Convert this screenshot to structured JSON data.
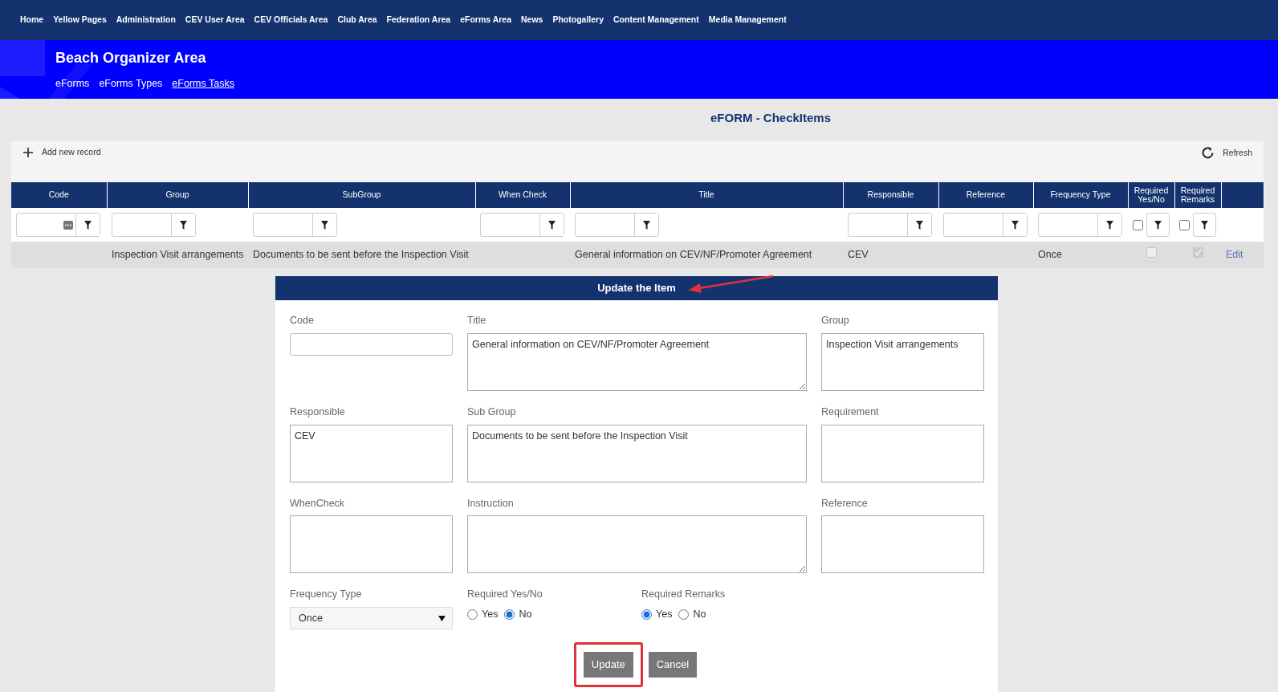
{
  "top_nav": [
    "Home",
    "Yellow Pages",
    "Administration",
    "CEV User Area",
    "CEV Officials Area",
    "Club Area",
    "Federation Area",
    "eForms Area",
    "News",
    "Photogallery",
    "Content Management",
    "Media Management"
  ],
  "banner": {
    "title": "Beach Organizer Area",
    "links": [
      {
        "label": "eForms",
        "selected": false
      },
      {
        "label": "eForms Types",
        "selected": false
      },
      {
        "label": "eForms Tasks",
        "selected": true
      }
    ]
  },
  "page_title": "eFORM - CheckItems",
  "toolbar": {
    "add_label": "Add new record",
    "refresh_label": "Refresh"
  },
  "table": {
    "columns": [
      {
        "label": "Code",
        "kind": "text-more"
      },
      {
        "label": "Group",
        "kind": "text"
      },
      {
        "label": "SubGroup",
        "kind": "text"
      },
      {
        "label": "When Check",
        "kind": "text"
      },
      {
        "label": "Title",
        "kind": "text"
      },
      {
        "label": "Responsible",
        "kind": "text"
      },
      {
        "label": "Reference",
        "kind": "text"
      },
      {
        "label": "Frequency Type",
        "kind": "text"
      },
      {
        "label": "Required Yes/No",
        "kind": "check",
        "filter_checked": false
      },
      {
        "label": "Required Remarks",
        "kind": "check",
        "filter_checked": false
      }
    ],
    "rows": [
      {
        "code": "",
        "group": "Inspection Visit arrangements",
        "subgroup": "Documents to be sent before the Inspection Visit",
        "when_check": "",
        "title": "General information on CEV/NF/Promoter Agreement",
        "responsible": "CEV",
        "reference": "",
        "frequency_type": "Once",
        "required_yes_no": false,
        "required_remarks": true,
        "action": "Edit"
      }
    ]
  },
  "form": {
    "title": "Update the Item",
    "title_arrow": true,
    "fields": [
      {
        "kind": "input",
        "label": "Code"
      },
      {
        "kind": "textarea",
        "label": "Title",
        "value": "General information on CEV/NF/Promoter Agreement",
        "resizable": true
      },
      {
        "kind": "textarea",
        "label": "Group",
        "value": "Inspection Visit arrangements"
      },
      {
        "kind": "textarea",
        "label": "Responsible",
        "value": "CEV"
      },
      {
        "kind": "textarea",
        "label": "Sub Group",
        "value": "Documents to be sent before the Inspection Visit"
      },
      {
        "kind": "textarea",
        "label": "Requirement"
      },
      {
        "kind": "textarea",
        "label": "WhenCheck"
      },
      {
        "kind": "textarea",
        "label": "Instruction",
        "resizable": true
      },
      {
        "kind": "textarea",
        "label": "Reference"
      },
      {
        "kind": "select",
        "label": "Frequency Type",
        "value": "Once"
      },
      {
        "kind": "radio",
        "label": "Required Yes/No",
        "options": [
          {
            "label": "Yes",
            "selected": false
          },
          {
            "label": "No",
            "selected": true
          }
        ]
      },
      {
        "kind": "radio",
        "label": "Required Remarks",
        "options": [
          {
            "label": "Yes",
            "selected": true
          },
          {
            "label": "No",
            "selected": false
          }
        ]
      }
    ],
    "buttons": [
      {
        "label": "Update",
        "highlighted": true
      },
      {
        "label": "Cancel"
      }
    ]
  }
}
